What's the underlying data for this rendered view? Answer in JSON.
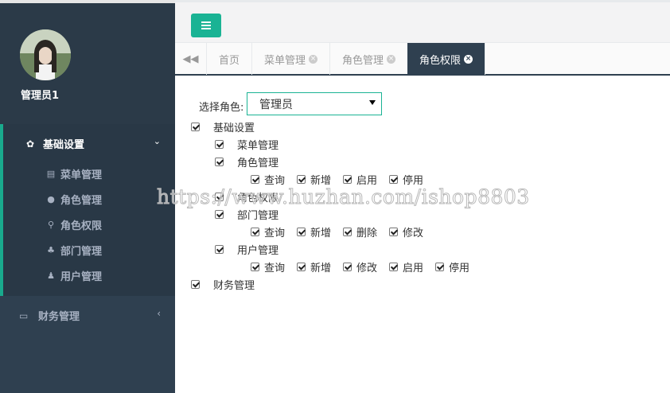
{
  "sidebar": {
    "username": "管理员1",
    "groups": [
      {
        "label": "基础设置",
        "icon": "gear-icon",
        "expanded": true,
        "items": [
          {
            "label": "菜单管理",
            "icon": "list-icon"
          },
          {
            "label": "角色管理",
            "icon": "users-icon"
          },
          {
            "label": "角色权限",
            "icon": "key-icon"
          },
          {
            "label": "部门管理",
            "icon": "sitemap-icon"
          },
          {
            "label": "用户管理",
            "icon": "user-icon"
          }
        ]
      },
      {
        "label": "财务管理",
        "icon": "credit-card-icon",
        "expanded": false
      }
    ]
  },
  "topbar": {
    "menu_toggle_icon": "hamburger-icon",
    "accent": "#1ab394"
  },
  "tabs": [
    {
      "label": "首页",
      "closable": false,
      "active": false
    },
    {
      "label": "菜单管理",
      "closable": true,
      "active": false
    },
    {
      "label": "角色管理",
      "closable": true,
      "active": false
    },
    {
      "label": "角色权限",
      "closable": true,
      "active": true
    }
  ],
  "content": {
    "role_label": "选择角色:",
    "role_selected": "管理员",
    "permissions": [
      {
        "label": "基础设置",
        "checked": true
      },
      {
        "label": "菜单管理",
        "checked": true
      },
      {
        "label": "角色管理",
        "checked": true,
        "actions": [
          "查询",
          "新增",
          "启用",
          "停用"
        ]
      },
      {
        "label": "角色权限",
        "checked": true
      },
      {
        "label": "部门管理",
        "checked": true,
        "actions": [
          "查询",
          "新增",
          "删除",
          "修改"
        ]
      },
      {
        "label": "用户管理",
        "checked": true,
        "actions": [
          "查询",
          "新增",
          "修改",
          "启用",
          "停用"
        ]
      },
      {
        "label": "财务管理",
        "checked": true
      }
    ]
  },
  "watermark": "https://www.huzhan.com/ishop8803",
  "colors": {
    "sidebar_bg": "#2f4050",
    "active_tab_bg": "#2f4050",
    "accent": "#1ab394"
  }
}
